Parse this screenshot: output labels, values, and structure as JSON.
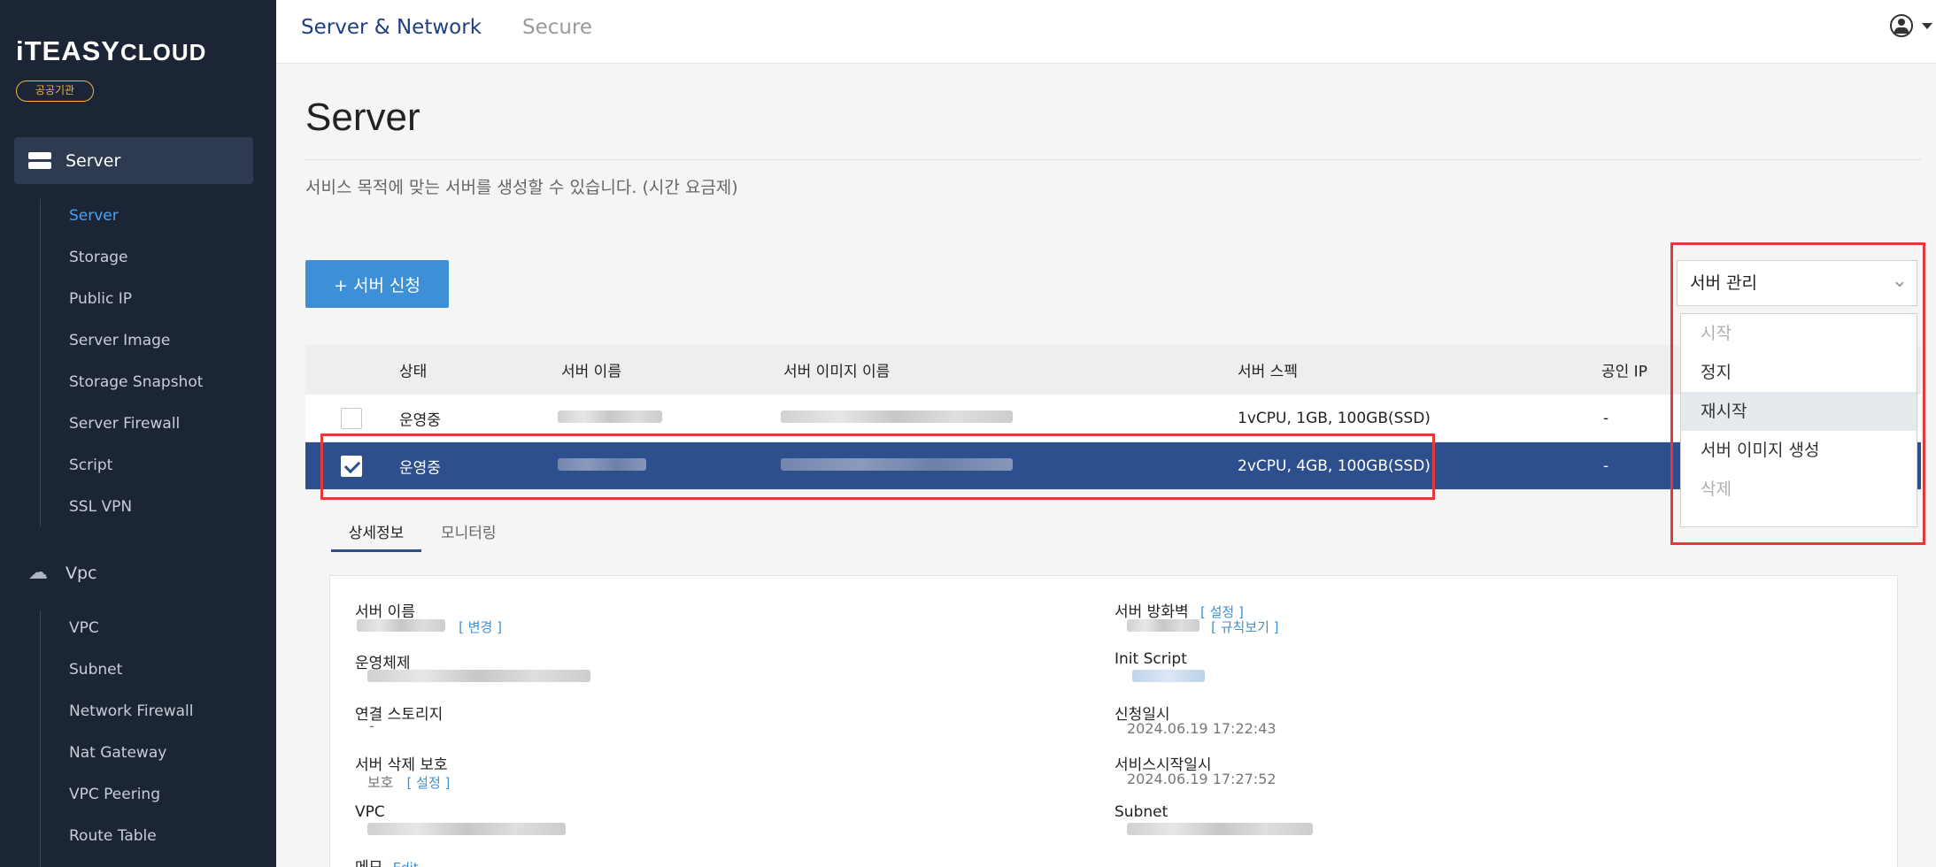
{
  "brand": {
    "logo_main": "iTEASY",
    "logo_sub": "CLOUD",
    "badge": "공공기관"
  },
  "sidebar": {
    "groups": [
      {
        "label": "Server",
        "items": [
          "Server",
          "Storage",
          "Public IP",
          "Server Image",
          "Storage Snapshot",
          "Server Firewall",
          "Script",
          "SSL VPN"
        ]
      },
      {
        "label": "Vpc",
        "items": [
          "VPC",
          "Subnet",
          "Network Firewall",
          "Nat Gateway",
          "VPC Peering",
          "Route Table"
        ]
      }
    ]
  },
  "topbar": {
    "tabs": [
      "Server & Network",
      "Secure"
    ]
  },
  "page": {
    "title": "Server",
    "description": "서비스 목적에 맞는 서버를 생성할 수 있습니다. (시간 요금제)",
    "add_button": "+ 서버 신청"
  },
  "manage": {
    "selected": "서버 관리",
    "options": [
      {
        "label": "시작",
        "disabled": true
      },
      {
        "label": "정지",
        "disabled": false
      },
      {
        "label": "재시작",
        "disabled": false,
        "hover": true
      },
      {
        "label": "서버 이미지 생성",
        "disabled": false
      },
      {
        "label": "삭제",
        "disabled": true
      }
    ]
  },
  "table": {
    "headers": [
      "상태",
      "서버 이름",
      "서버 이미지 이름",
      "서버 스펙",
      "공인 IP"
    ],
    "rows": [
      {
        "checked": false,
        "status": "운영중",
        "spec": "1vCPU, 1GB, 100GB(SSD)",
        "ip": "-"
      },
      {
        "checked": true,
        "status": "운영중",
        "spec": "2vCPU, 4GB, 100GB(SSD)",
        "ip": "-"
      }
    ]
  },
  "detail": {
    "tabs": [
      "상세정보",
      "모니터링"
    ],
    "fields": {
      "server_name": "서버 이름",
      "change_link": "[ 변경 ]",
      "os": "운영체제",
      "storage": "연결 스토리지",
      "storage_val": "-",
      "delete_protect": "서버 삭제 보호",
      "protect_val": "보호",
      "set_link": "[ 설정 ]",
      "vpc": "VPC",
      "memo": "메모",
      "edit_link": "Edit",
      "firewall": "서버 방화벽",
      "firewall_set": "[ 설정 ]",
      "rules_link": "[ 규칙보기 ]",
      "init_script": "Init Script",
      "request_date": "신청일시",
      "request_val": "2024.06.19 17:22:43",
      "start_date": "서비스시작일시",
      "start_val": "2024.06.19 17:27:52",
      "subnet": "Subnet"
    }
  }
}
